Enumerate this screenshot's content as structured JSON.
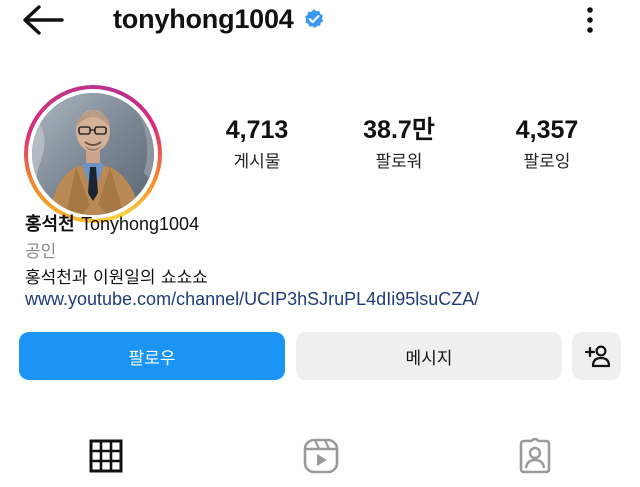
{
  "header": {
    "username": "tonyhong1004",
    "back_icon": "arrow-left-icon",
    "verified_icon": "verified-badge-icon",
    "more_icon": "more-vertical-icon"
  },
  "stats": {
    "posts": {
      "value": "4,713",
      "label": "게시물"
    },
    "followers": {
      "value": "38.7만",
      "label": "팔로워"
    },
    "following": {
      "value": "4,357",
      "label": "팔로잉"
    }
  },
  "bio": {
    "name_ko": "홍석천",
    "name_en": "Tonyhong1004",
    "category": "공인",
    "text": "홍석천과 이원일의 쇼쇼쇼",
    "link": "www.youtube.com/channel/UCIP3hSJruPL4dIi95lsuCZA/"
  },
  "actions": {
    "follow_label": "팔로우",
    "message_label": "메시지",
    "add_icon": "add-person-icon"
  },
  "tabs": [
    {
      "icon": "grid-icon"
    },
    {
      "icon": "reels-icon"
    },
    {
      "icon": "tagged-icon"
    }
  ],
  "colors": {
    "follow_button": "#1a95f5",
    "secondary_button": "#efefef",
    "verified": "#3897f0",
    "link": "#1f3c7a",
    "category": "#8a8a8a"
  }
}
